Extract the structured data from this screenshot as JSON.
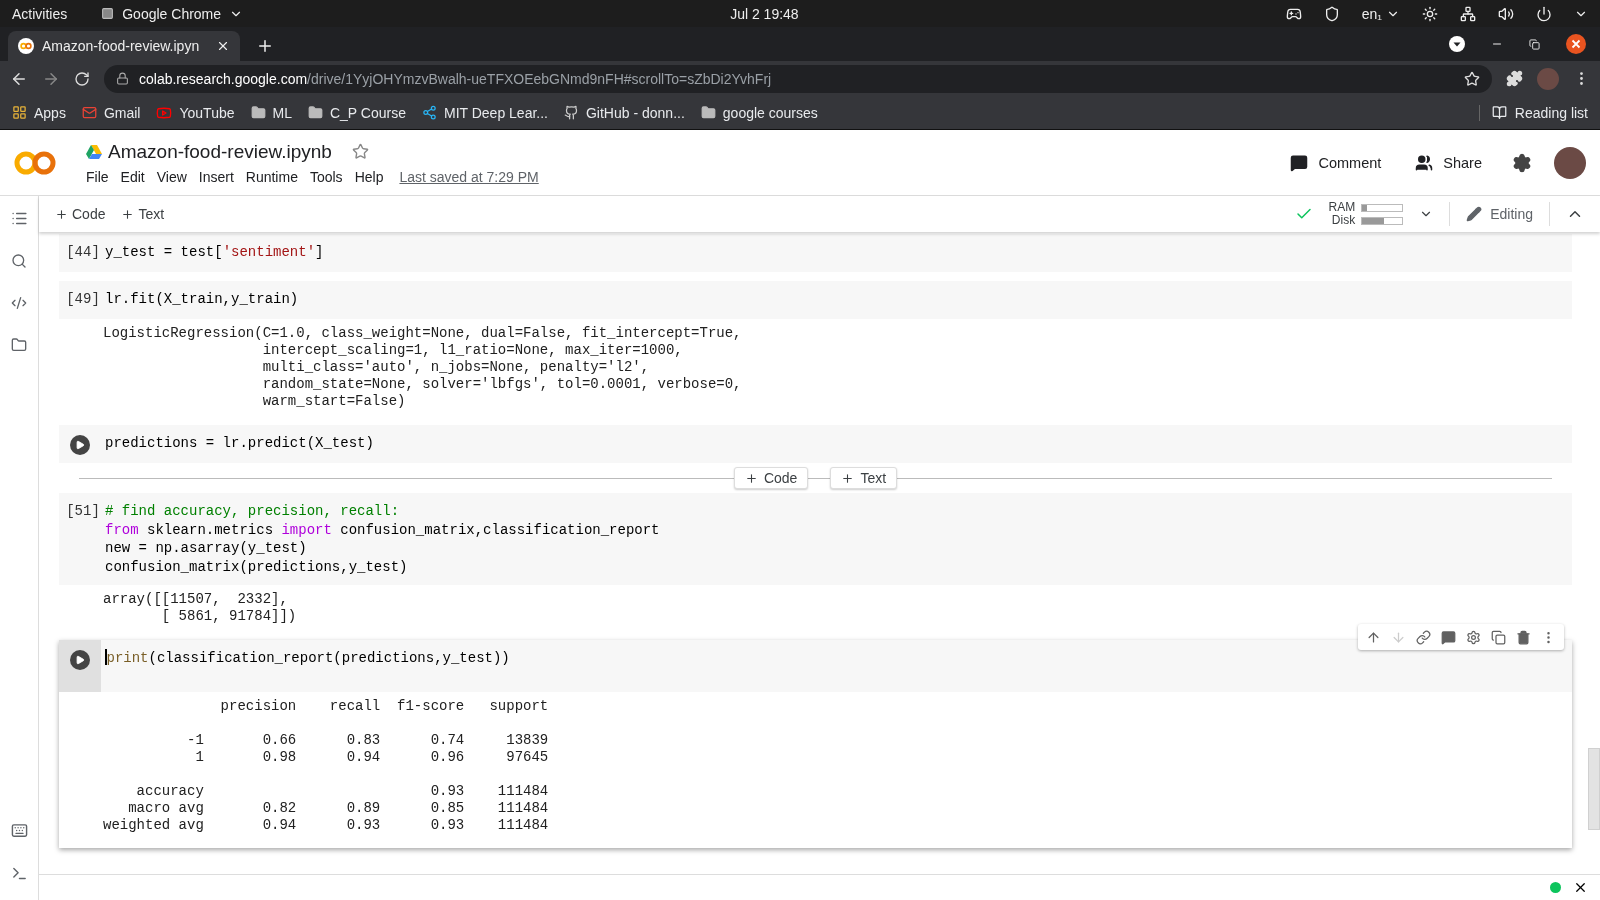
{
  "system_bar": {
    "activities": "Activities",
    "app": "Google Chrome",
    "clock": "Jul 2  19:48",
    "language": "en₁"
  },
  "browser": {
    "tab_title": "Amazon-food-review.ipyn",
    "url_host": "colab.research.google.com",
    "url_path": "/drive/1YyjOHYmzvBwalh-ueTFXOEebGNmd9nFH#scrollTo=sZbDi2YvhFrj",
    "bookmarks": [
      {
        "kind": "apps",
        "label": "Apps"
      },
      {
        "kind": "gmail",
        "label": "Gmail"
      },
      {
        "kind": "youtube",
        "label": "YouTube"
      },
      {
        "kind": "folder",
        "label": "ML"
      },
      {
        "kind": "folder",
        "label": "C_P Course"
      },
      {
        "kind": "mit",
        "label": "MIT Deep Lear..."
      },
      {
        "kind": "github",
        "label": "GitHub - donn..."
      },
      {
        "kind": "folder",
        "label": "google courses"
      }
    ],
    "reading_list": "Reading list"
  },
  "colab": {
    "title": "Amazon-food-review.ipynb",
    "menus": [
      "File",
      "Edit",
      "View",
      "Insert",
      "Runtime",
      "Tools",
      "Help"
    ],
    "last_saved": "Last saved at 7:29 PM",
    "comment": "Comment",
    "share": "Share",
    "toolbar": {
      "add_code": "Code",
      "add_text": "Text",
      "ram_label": "RAM",
      "ram": {
        "level": 0.12
      },
      "disk_label": "Disk",
      "disk": {
        "level": 0.55
      },
      "editing": "Editing"
    }
  },
  "cells": [
    {
      "kind": "code",
      "prompt": "[44]",
      "selected": false,
      "code": [
        [
          {
            "kind": "plain",
            "text": "y_test = test["
          },
          {
            "kind": "string",
            "text": "'sentiment'"
          },
          {
            "kind": "plain",
            "text": "]"
          }
        ]
      ]
    },
    {
      "kind": "code",
      "prompt": "[49]",
      "selected": false,
      "code": [
        [
          {
            "kind": "plain",
            "text": "lr.fit(X_train,y_train)"
          }
        ]
      ],
      "output": "LogisticRegression(C=1.0, class_weight=None, dual=False, fit_intercept=True,\n                   intercept_scaling=1, l1_ratio=None, max_iter=1000,\n                   multi_class='auto', n_jobs=None, penalty='l2',\n                   random_state=None, solver='lbfgs', tol=0.0001, verbose=0,\n                   warm_start=False)"
    },
    {
      "kind": "code",
      "selected": false,
      "code": [
        [
          {
            "kind": "plain",
            "text": "predictions = lr.predict(X_test)"
          }
        ]
      ]
    },
    {
      "kind": "insert",
      "add_code": "Code",
      "add_text": "Text"
    },
    {
      "kind": "code",
      "prompt": "[51]",
      "selected": false,
      "code": [
        [
          {
            "kind": "comment",
            "text": "# find accuracy, precision, recall:"
          }
        ],
        [
          {
            "kind": "keyword",
            "text": "from"
          },
          {
            "kind": "plain",
            "text": " sklearn.metrics "
          },
          {
            "kind": "keyword",
            "text": "import"
          },
          {
            "kind": "plain",
            "text": " confusion_matrix,classification_report"
          }
        ],
        [
          {
            "kind": "plain",
            "text": "new = np.asarray(y_test)"
          }
        ],
        [
          {
            "kind": "plain",
            "text": "confusion_matrix(predictions,y_test)"
          }
        ]
      ],
      "output": "array([[11507,  2332],\n       [ 5861, 91784]])"
    },
    {
      "kind": "code",
      "selected": true,
      "code": [
        [
          {
            "kind": "builtin",
            "text": "print"
          },
          {
            "kind": "plain",
            "text": "(classification_report(predictions,y_test))"
          }
        ]
      ],
      "output": "              precision    recall  f1-score   support\n\n          -1       0.66      0.83      0.74     13839\n           1       0.98      0.94      0.96     97645\n\n    accuracy                           0.93    111484\n   macro avg       0.82      0.89      0.85    111484\nweighted avg       0.94      0.93      0.93    111484"
    }
  ]
}
